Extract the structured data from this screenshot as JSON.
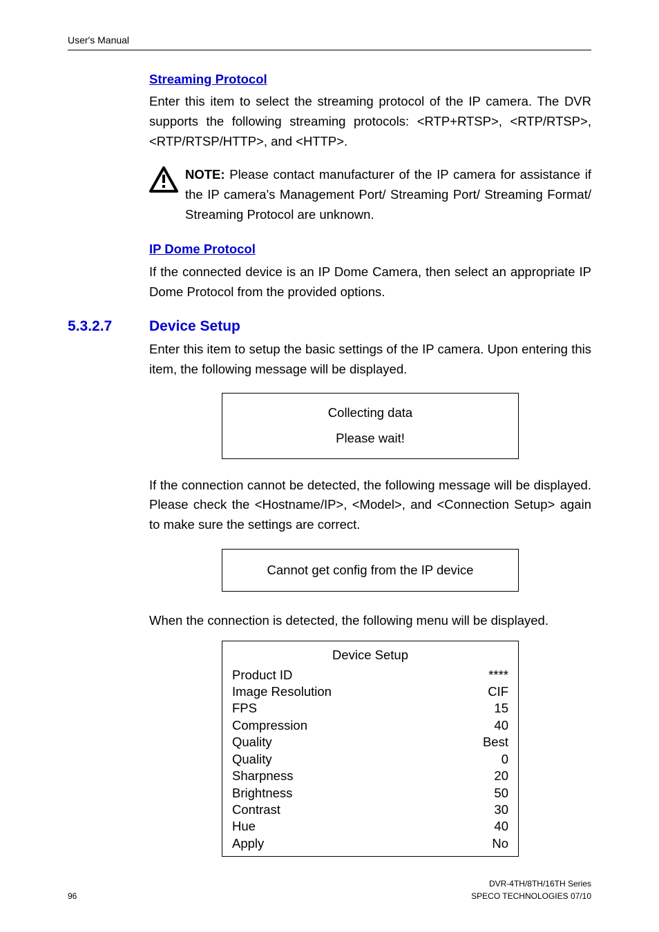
{
  "header": {
    "left": "User's Manual"
  },
  "streaming": {
    "heading": "Streaming Protocol",
    "body": "Enter this item to select the streaming protocol of the IP camera. The DVR supports the following streaming protocols: <RTP+RTSP>, <RTP/RTSP>, <RTP/RTSP/HTTP>, and <HTTP>."
  },
  "note": {
    "icon_name": "warning-icon",
    "label": "NOTE:",
    "text": " Please contact manufacturer of the IP camera for assistance if the IP camera's Management Port/ Streaming Port/ Streaming Format/ Streaming Protocol are unknown."
  },
  "ipdome": {
    "heading": "IP Dome Protocol",
    "body": "If the connected device is an IP Dome Camera, then select an appropriate IP Dome Protocol from the provided options."
  },
  "section": {
    "number": "5.3.2.7",
    "title": "Device Setup",
    "intro": "Enter this item to setup the basic settings of the IP camera. Upon entering this item, the following message will be displayed."
  },
  "msg1": {
    "line1": "Collecting data",
    "line2": "Please wait!"
  },
  "para2": "If the connection cannot be detected, the following message will be displayed. Please check the <Hostname/IP>, <Model>, and <Connection Setup> again to make sure the settings are correct.",
  "msg2": {
    "line1": "Cannot get config from the IP device"
  },
  "para3": "When the connection is detected, the following menu will be displayed.",
  "device_table": {
    "title": "Device Setup",
    "rows": [
      {
        "label": "Product ID",
        "value": "****"
      },
      {
        "label": "Image Resolution",
        "value": "CIF"
      },
      {
        "label": "FPS",
        "value": "15"
      },
      {
        "label": "Compression",
        "value": "40"
      },
      {
        "label": "Quality",
        "value": "Best"
      },
      {
        "label": "Quality",
        "value": "0"
      },
      {
        "label": "Sharpness",
        "value": "20"
      },
      {
        "label": "Brightness",
        "value": "50"
      },
      {
        "label": "Contrast",
        "value": "30"
      },
      {
        "label": "Hue",
        "value": "40"
      },
      {
        "label": "Apply",
        "value": "No"
      }
    ]
  },
  "footer": {
    "page": "96",
    "right1": "DVR-4TH/8TH/16TH Series",
    "right2": "SPECO TECHNOLOGIES 07/10"
  }
}
